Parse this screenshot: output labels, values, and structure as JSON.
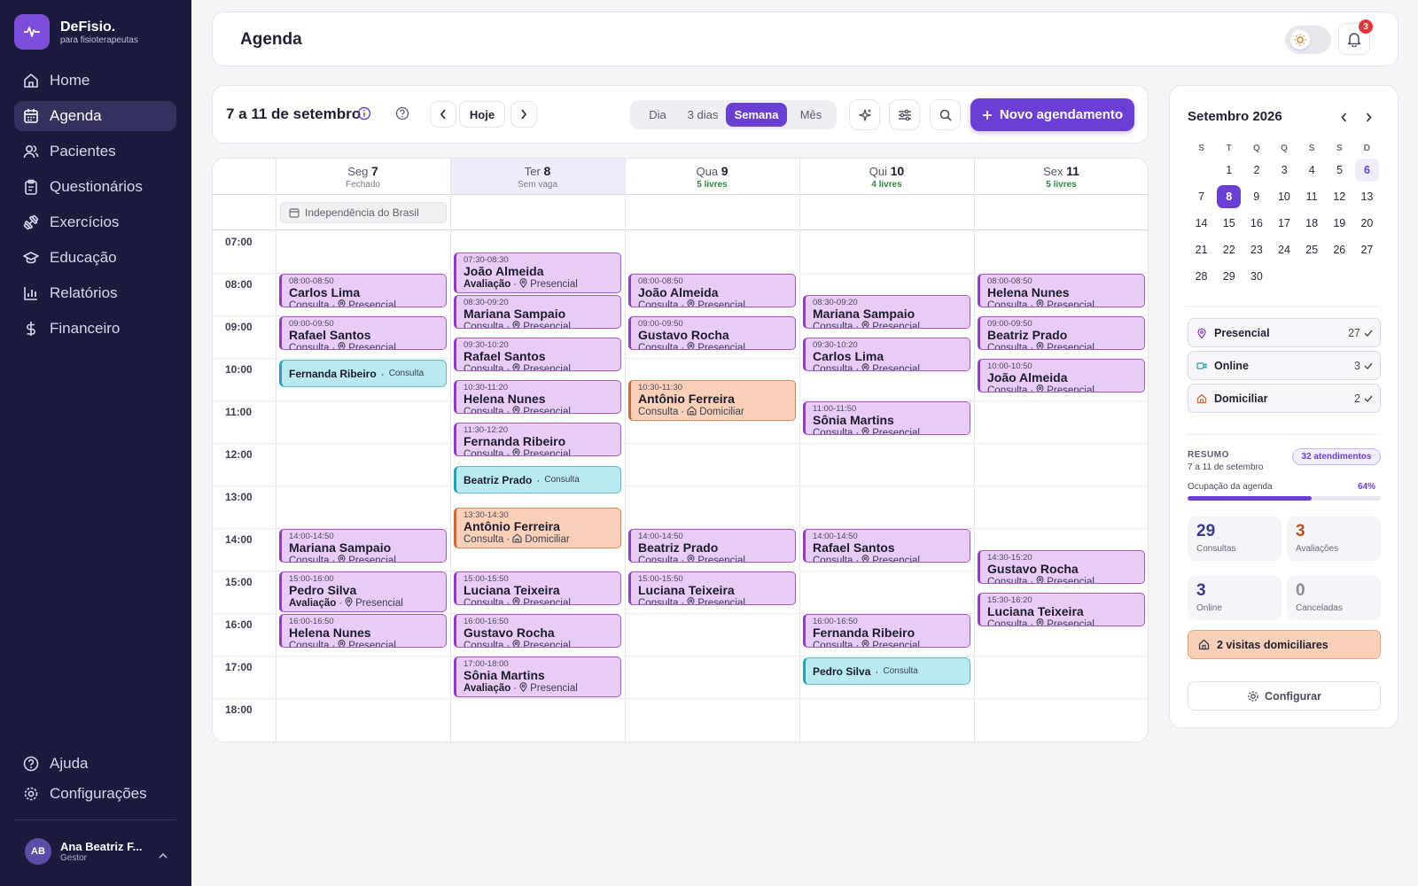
{
  "brand": {
    "name": "DeFisio.",
    "tagline": "para fisioterapeutas"
  },
  "nav": [
    {
      "label": "Home",
      "icon": "home-icon",
      "active": false
    },
    {
      "label": "Agenda",
      "icon": "calendar-icon",
      "active": true
    },
    {
      "label": "Pacientes",
      "icon": "users-icon",
      "active": false
    },
    {
      "label": "Questionários",
      "icon": "clipboard-icon",
      "active": false
    },
    {
      "label": "Exercícios",
      "icon": "dumbbell-icon",
      "active": false
    },
    {
      "label": "Educação",
      "icon": "graduation-cap-icon",
      "active": false
    },
    {
      "label": "Relatórios",
      "icon": "bar-chart-icon",
      "active": false
    },
    {
      "label": "Financeiro",
      "icon": "dollar-icon",
      "active": false
    }
  ],
  "nav_bottom": [
    {
      "label": "Ajuda",
      "icon": "help-icon"
    },
    {
      "label": "Configurações",
      "icon": "gear-icon"
    }
  ],
  "user": {
    "initials": "AB",
    "name": "Ana Beatriz F...",
    "role": "Gestor"
  },
  "header": {
    "title": "Agenda",
    "notification_count": "3"
  },
  "toolbar": {
    "range": "7 a 11 de setembro",
    "today": "Hoje",
    "views": [
      "Dia",
      "3 dias",
      "Semana",
      "Mês"
    ],
    "active_view": "Semana",
    "new_button": "Novo agendamento"
  },
  "calendar": {
    "days": [
      {
        "dow": "Seg",
        "num": "7",
        "sub": "Fechado",
        "free": false,
        "today": false
      },
      {
        "dow": "Ter",
        "num": "8",
        "sub": "Sem vaga",
        "free": false,
        "today": true
      },
      {
        "dow": "Qua",
        "num": "9",
        "sub": "5 livres",
        "free": true,
        "today": false
      },
      {
        "dow": "Qui",
        "num": "10",
        "sub": "4 livres",
        "free": true,
        "today": false
      },
      {
        "dow": "Sex",
        "num": "11",
        "sub": "5 livres",
        "free": true,
        "today": false
      }
    ],
    "holiday": "Independência do Brasil",
    "hours": [
      "07:00",
      "08:00",
      "09:00",
      "10:00",
      "11:00",
      "12:00",
      "13:00",
      "14:00",
      "15:00",
      "16:00",
      "17:00",
      "18:00"
    ],
    "events": [
      {
        "day": 0,
        "start": 8,
        "end": 8.83,
        "time": "08:00-08:50",
        "name": "Carlos Lima",
        "type": "Consulta",
        "mode": "Presencial"
      },
      {
        "day": 0,
        "start": 9,
        "end": 9.83,
        "time": "09:00-09:50",
        "name": "Rafael Santos",
        "type": "Consulta",
        "mode": "Presencial"
      },
      {
        "day": 0,
        "start": 10,
        "end": 10.67,
        "name": "Fernanda Ribeiro",
        "type": "Consulta",
        "mode": "Online"
      },
      {
        "day": 0,
        "start": 14,
        "end": 14.83,
        "time": "14:00-14:50",
        "name": "Mariana Sampaio",
        "type": "Consulta",
        "mode": "Presencial"
      },
      {
        "day": 0,
        "start": 15,
        "end": 16,
        "time": "15:00-16:00",
        "name": "Pedro Silva",
        "type": "Avaliação",
        "mode": "Presencial"
      },
      {
        "day": 0,
        "start": 16,
        "end": 16.83,
        "time": "16:00-16:50",
        "name": "Helena Nunes",
        "type": "Consulta",
        "mode": "Presencial"
      },
      {
        "day": 1,
        "start": 7.5,
        "end": 8.5,
        "time": "07:30-08:30",
        "name": "João Almeida",
        "type": "Avaliação",
        "mode": "Presencial"
      },
      {
        "day": 1,
        "start": 8.5,
        "end": 9.33,
        "time": "08:30-09:20",
        "name": "Mariana Sampaio",
        "type": "Consulta",
        "mode": "Presencial"
      },
      {
        "day": 1,
        "start": 9.5,
        "end": 10.33,
        "time": "09:30-10:20",
        "name": "Rafael Santos",
        "type": "Consulta",
        "mode": "Presencial"
      },
      {
        "day": 1,
        "start": 10.5,
        "end": 11.33,
        "time": "10:30-11:20",
        "name": "Helena Nunes",
        "type": "Consulta",
        "mode": "Presencial"
      },
      {
        "day": 1,
        "start": 11.5,
        "end": 12.33,
        "time": "11:30-12:20",
        "name": "Fernanda Ribeiro",
        "type": "Consulta",
        "mode": "Presencial"
      },
      {
        "day": 1,
        "start": 12.5,
        "end": 13.17,
        "name": "Beatriz Prado",
        "type": "Consulta",
        "mode": "Online"
      },
      {
        "day": 1,
        "start": 13.5,
        "end": 14.5,
        "time": "13:30-14:30",
        "name": "Antônio Ferreira",
        "type": "Consulta",
        "mode": "Domiciliar"
      },
      {
        "day": 1,
        "start": 15,
        "end": 15.83,
        "time": "15:00-15:50",
        "name": "Luciana Teixeira",
        "type": "Consulta",
        "mode": "Presencial"
      },
      {
        "day": 1,
        "start": 16,
        "end": 16.83,
        "time": "16:00-16:50",
        "name": "Gustavo Rocha",
        "type": "Consulta",
        "mode": "Presencial"
      },
      {
        "day": 1,
        "start": 17,
        "end": 18,
        "time": "17:00-18:00",
        "name": "Sônia Martins",
        "type": "Avaliação",
        "mode": "Presencial"
      },
      {
        "day": 2,
        "start": 8,
        "end": 8.83,
        "time": "08:00-08:50",
        "name": "João Almeida",
        "type": "Consulta",
        "mode": "Presencial"
      },
      {
        "day": 2,
        "start": 9,
        "end": 9.83,
        "time": "09:00-09:50",
        "name": "Gustavo Rocha",
        "type": "Consulta",
        "mode": "Presencial"
      },
      {
        "day": 2,
        "start": 10.5,
        "end": 11.5,
        "time": "10:30-11:30",
        "name": "Antônio Ferreira",
        "type": "Consulta",
        "mode": "Domiciliar"
      },
      {
        "day": 2,
        "start": 14,
        "end": 14.83,
        "time": "14:00-14:50",
        "name": "Beatriz Prado",
        "type": "Consulta",
        "mode": "Presencial"
      },
      {
        "day": 2,
        "start": 15,
        "end": 15.83,
        "time": "15:00-15:50",
        "name": "Luciana Teixeira",
        "type": "Consulta",
        "mode": "Presencial"
      },
      {
        "day": 3,
        "start": 8.5,
        "end": 9.33,
        "time": "08:30-09:20",
        "name": "Mariana Sampaio",
        "type": "Consulta",
        "mode": "Presencial"
      },
      {
        "day": 3,
        "start": 9.5,
        "end": 10.33,
        "time": "09:30-10:20",
        "name": "Carlos Lima",
        "type": "Consulta",
        "mode": "Presencial"
      },
      {
        "day": 3,
        "start": 11,
        "end": 11.83,
        "time": "11:00-11:50",
        "name": "Sônia Martins",
        "type": "Consulta",
        "mode": "Presencial"
      },
      {
        "day": 3,
        "start": 14,
        "end": 14.83,
        "time": "14:00-14:50",
        "name": "Rafael Santos",
        "type": "Consulta",
        "mode": "Presencial"
      },
      {
        "day": 3,
        "start": 16,
        "end": 16.83,
        "time": "16:00-16:50",
        "name": "Fernanda Ribeiro",
        "type": "Consulta",
        "mode": "Presencial"
      },
      {
        "day": 3,
        "start": 17,
        "end": 17.67,
        "name": "Pedro Silva",
        "type": "Consulta",
        "mode": "Online"
      },
      {
        "day": 4,
        "start": 8,
        "end": 8.83,
        "time": "08:00-08:50",
        "name": "Helena Nunes",
        "type": "Consulta",
        "mode": "Presencial"
      },
      {
        "day": 4,
        "start": 9,
        "end": 9.83,
        "time": "09:00-09:50",
        "name": "Beatriz Prado",
        "type": "Consulta",
        "mode": "Presencial"
      },
      {
        "day": 4,
        "start": 10,
        "end": 10.83,
        "time": "10:00-10:50",
        "name": "João Almeida",
        "type": "Consulta",
        "mode": "Presencial"
      },
      {
        "day": 4,
        "start": 14.5,
        "end": 15.33,
        "time": "14:30-15:20",
        "name": "Gustavo Rocha",
        "type": "Consulta",
        "mode": "Presencial"
      },
      {
        "day": 4,
        "start": 15.5,
        "end": 16.33,
        "time": "15:30-16:20",
        "name": "Luciana Teixeira",
        "type": "Consulta",
        "mode": "Presencial"
      }
    ]
  },
  "mini_calendar": {
    "title": "Setembro 2026",
    "weekdays": [
      "S",
      "T",
      "Q",
      "Q",
      "S",
      "S",
      "D"
    ],
    "weeks": [
      [
        "",
        "1",
        "2",
        "3",
        "4",
        "5",
        "6"
      ],
      [
        "7",
        "8",
        "9",
        "10",
        "11",
        "12",
        "13"
      ],
      [
        "14",
        "15",
        "16",
        "17",
        "18",
        "19",
        "20"
      ],
      [
        "21",
        "22",
        "23",
        "24",
        "25",
        "26",
        "27"
      ],
      [
        "28",
        "29",
        "30",
        "",
        "",
        "",
        ""
      ]
    ],
    "selected": "8",
    "today": "6"
  },
  "filters": [
    {
      "label": "Presencial",
      "count": "27",
      "icon": "map-pin-icon",
      "color": "#8e3fc0"
    },
    {
      "label": "Online",
      "count": "3",
      "icon": "video-icon",
      "color": "#2aa0b0"
    },
    {
      "label": "Domiciliar",
      "count": "2",
      "icon": "house-icon",
      "color": "#c96a35"
    }
  ],
  "summary": {
    "label": "RESUMO",
    "range": "7 a 11 de setembro",
    "badge": "32 atendimentos",
    "occupancy_label": "Ocupação da agenda",
    "occupancy_text": "64%",
    "occupancy": 0.64,
    "stats": [
      {
        "value": "29",
        "label": "Consultas",
        "color": "#3a3a8c"
      },
      {
        "value": "3",
        "label": "Avaliações",
        "color": "#b8521e"
      },
      {
        "value": "3",
        "label": "Online",
        "color": "#3a3a8c"
      },
      {
        "value": "0",
        "label": "Canceladas",
        "color": "#8a8a9a"
      }
    ],
    "visits": "2 visitas domiciliares",
    "config": "Configurar"
  }
}
